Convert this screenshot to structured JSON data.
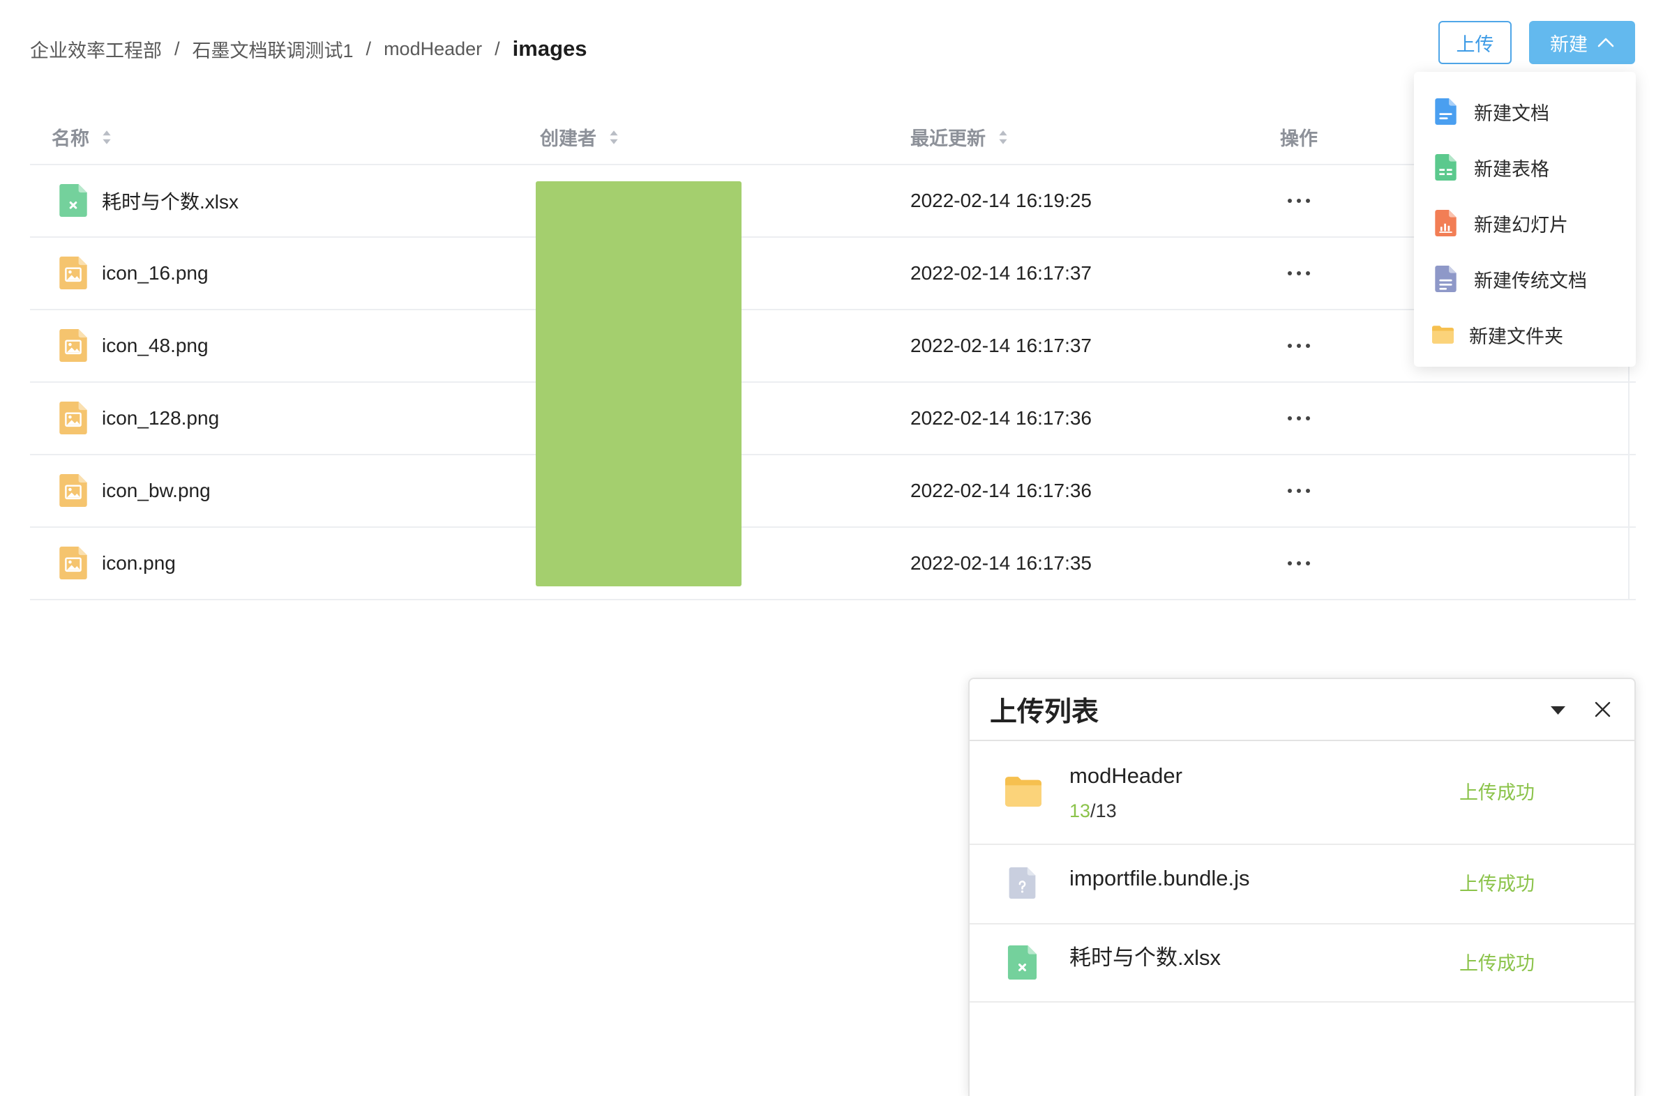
{
  "breadcrumb": {
    "items": [
      "企业效率工程部",
      "石墨文档联调测试1",
      "modHeader"
    ],
    "separator": "/",
    "current": "images"
  },
  "toolbar": {
    "upload_label": "上传",
    "new_label": "新建",
    "new_icon": "chevron-up-icon"
  },
  "new_menu": {
    "items": [
      {
        "label": "新建文档",
        "icon": "document-icon",
        "color": "#4a9ff0"
      },
      {
        "label": "新建表格",
        "icon": "spreadsheet-icon",
        "color": "#5bc98d"
      },
      {
        "label": "新建幻灯片",
        "icon": "slides-icon",
        "color": "#f27e55"
      },
      {
        "label": "新建传统文档",
        "icon": "classic-document-icon",
        "color": "#8e98c8"
      },
      {
        "label": "新建文件夹",
        "icon": "folder-icon",
        "color": "#f8c75d"
      }
    ]
  },
  "table": {
    "columns": {
      "name": "名称",
      "creator": "创建者",
      "updated": "最近更新",
      "actions": "操作"
    },
    "rows": [
      {
        "name": "耗时与个数.xlsx",
        "icon": "xlsx-file-icon",
        "updated": "2022-02-14 16:19:25"
      },
      {
        "name": "icon_16.png",
        "icon": "image-file-icon",
        "updated": "2022-02-14 16:17:37"
      },
      {
        "name": "icon_48.png",
        "icon": "image-file-icon",
        "updated": "2022-02-14 16:17:37"
      },
      {
        "name": "icon_128.png",
        "icon": "image-file-icon",
        "updated": "2022-02-14 16:17:36"
      },
      {
        "name": "icon_bw.png",
        "icon": "image-file-icon",
        "updated": "2022-02-14 16:17:36"
      },
      {
        "name": "icon.png",
        "icon": "image-file-icon",
        "updated": "2022-02-14 16:17:35"
      }
    ]
  },
  "upload_panel": {
    "title": "上传列表",
    "items": [
      {
        "name": "modHeader",
        "icon": "folder-icon",
        "progress": {
          "done": "13",
          "separator": "/",
          "total": "13"
        },
        "status": "上传成功"
      },
      {
        "name": "importfile.bundle.js",
        "icon": "unknown-file-icon",
        "status": "上传成功"
      },
      {
        "name": "耗时与个数.xlsx",
        "icon": "xlsx-file-icon",
        "status": "上传成功"
      }
    ]
  },
  "colors": {
    "accent": "#4fa6e8",
    "primary_button": "#63b9ee",
    "success": "#8bc34a",
    "redaction": "#a4cf6e"
  }
}
